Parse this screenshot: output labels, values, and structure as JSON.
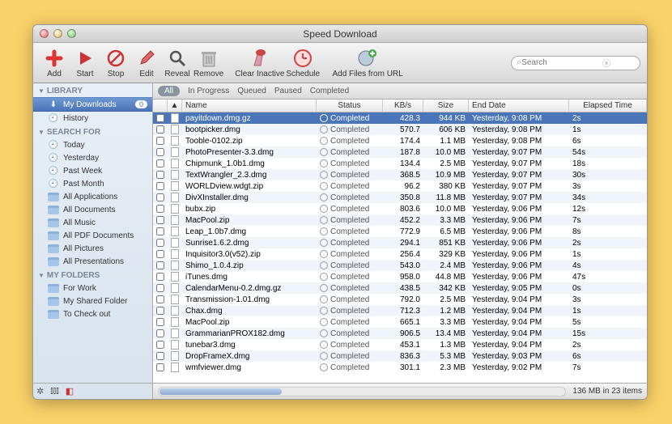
{
  "window": {
    "title": "Speed Download"
  },
  "toolbar": {
    "add": "Add",
    "start": "Start",
    "stop": "Stop",
    "edit": "Edit",
    "reveal": "Reveal",
    "remove": "Remove",
    "clear": "Clear Inactive",
    "schedule": "Schedule",
    "addurl": "Add Files from URL",
    "search_placeholder": "Search"
  },
  "sidebar": {
    "library_label": "LIBRARY",
    "mydownloads": "My Downloads",
    "mydownloads_badge": "0",
    "history": "History",
    "search_label": "SEARCH FOR",
    "search_items": [
      "Today",
      "Yesterday",
      "Past Week",
      "Past Month",
      "All Applications",
      "All Documents",
      "All Music",
      "All PDF Documents",
      "All Pictures",
      "All Presentations"
    ],
    "folders_label": "MY FOLDERS",
    "folders": [
      "For Work",
      "My Shared Folder",
      "To Check out"
    ]
  },
  "filters": {
    "all": "All",
    "inprogress": "In Progress",
    "queued": "Queued",
    "paused": "Paused",
    "completed": "Completed"
  },
  "columns": {
    "name": "Name",
    "status": "Status",
    "kbs": "KB/s",
    "size": "Size",
    "date": "End Date",
    "elapsed": "Elapsed Time"
  },
  "rows": [
    {
      "name": "payitdown.dmg.gz",
      "status": "Completed",
      "kbs": "428.3",
      "size": "944 KB",
      "date": "Yesterday, 9:08 PM",
      "elapsed": "2s",
      "sel": true
    },
    {
      "name": "bootpicker.dmg",
      "status": "Completed",
      "kbs": "570.7",
      "size": "606 KB",
      "date": "Yesterday, 9:08 PM",
      "elapsed": "1s"
    },
    {
      "name": "Tooble-0102.zip",
      "status": "Completed",
      "kbs": "174.4",
      "size": "1.1 MB",
      "date": "Yesterday, 9:08 PM",
      "elapsed": "6s"
    },
    {
      "name": "PhotoPresenter-3.3.dmg",
      "status": "Completed",
      "kbs": "187.8",
      "size": "10.0 MB",
      "date": "Yesterday, 9:07 PM",
      "elapsed": "54s"
    },
    {
      "name": "Chipmunk_1.0b1.dmg",
      "status": "Completed",
      "kbs": "134.4",
      "size": "2.5 MB",
      "date": "Yesterday, 9:07 PM",
      "elapsed": "18s"
    },
    {
      "name": "TextWrangler_2.3.dmg",
      "status": "Completed",
      "kbs": "368.5",
      "size": "10.9 MB",
      "date": "Yesterday, 9:07 PM",
      "elapsed": "30s"
    },
    {
      "name": "WORLDview.wdgt.zip",
      "status": "Completed",
      "kbs": "96.2",
      "size": "380 KB",
      "date": "Yesterday, 9:07 PM",
      "elapsed": "3s"
    },
    {
      "name": "DivXInstaller.dmg",
      "status": "Completed",
      "kbs": "350.8",
      "size": "11.8 MB",
      "date": "Yesterday, 9:07 PM",
      "elapsed": "34s"
    },
    {
      "name": "bubx.zip",
      "status": "Completed",
      "kbs": "803.6",
      "size": "10.0 MB",
      "date": "Yesterday, 9:06 PM",
      "elapsed": "12s"
    },
    {
      "name": "MacPool.zip",
      "status": "Completed",
      "kbs": "452.2",
      "size": "3.3 MB",
      "date": "Yesterday, 9:06 PM",
      "elapsed": "7s"
    },
    {
      "name": "Leap_1.0b7.dmg",
      "status": "Completed",
      "kbs": "772.9",
      "size": "6.5 MB",
      "date": "Yesterday, 9:06 PM",
      "elapsed": "8s"
    },
    {
      "name": "Sunrise1.6.2.dmg",
      "status": "Completed",
      "kbs": "294.1",
      "size": "851 KB",
      "date": "Yesterday, 9:06 PM",
      "elapsed": "2s"
    },
    {
      "name": "Inquisitor3.0(v52).zip",
      "status": "Completed",
      "kbs": "256.4",
      "size": "329 KB",
      "date": "Yesterday, 9:06 PM",
      "elapsed": "1s"
    },
    {
      "name": "Shimo_1.0.4.zip",
      "status": "Completed",
      "kbs": "543.0",
      "size": "2.4 MB",
      "date": "Yesterday, 9:06 PM",
      "elapsed": "4s"
    },
    {
      "name": "iTunes.dmg",
      "status": "Completed",
      "kbs": "958.0",
      "size": "44.8 MB",
      "date": "Yesterday, 9:06 PM",
      "elapsed": "47s"
    },
    {
      "name": "CalendarMenu-0.2.dmg.gz",
      "status": "Completed",
      "kbs": "438.5",
      "size": "342 KB",
      "date": "Yesterday, 9:05 PM",
      "elapsed": "0s"
    },
    {
      "name": "Transmission-1.01.dmg",
      "status": "Completed",
      "kbs": "792.0",
      "size": "2.5 MB",
      "date": "Yesterday, 9:04 PM",
      "elapsed": "3s"
    },
    {
      "name": "Chax.dmg",
      "status": "Completed",
      "kbs": "712.3",
      "size": "1.2 MB",
      "date": "Yesterday, 9:04 PM",
      "elapsed": "1s"
    },
    {
      "name": "MacPool.zip",
      "status": "Completed",
      "kbs": "665.1",
      "size": "3.3 MB",
      "date": "Yesterday, 9:04 PM",
      "elapsed": "5s"
    },
    {
      "name": "GrammarianPROX182.dmg",
      "status": "Completed",
      "kbs": "906.5",
      "size": "13.4 MB",
      "date": "Yesterday, 9:04 PM",
      "elapsed": "15s"
    },
    {
      "name": "tunebar3.dmg",
      "status": "Completed",
      "kbs": "453.1",
      "size": "1.3 MB",
      "date": "Yesterday, 9:04 PM",
      "elapsed": "2s"
    },
    {
      "name": "DropFrameX.dmg",
      "status": "Completed",
      "kbs": "836.3",
      "size": "5.3 MB",
      "date": "Yesterday, 9:03 PM",
      "elapsed": "6s"
    },
    {
      "name": "wmfviewer.dmg",
      "status": "Completed",
      "kbs": "301.1",
      "size": "2.3 MB",
      "date": "Yesterday, 9:02 PM",
      "elapsed": "7s"
    }
  ],
  "status": {
    "summary": "136 MB in 23 items"
  }
}
